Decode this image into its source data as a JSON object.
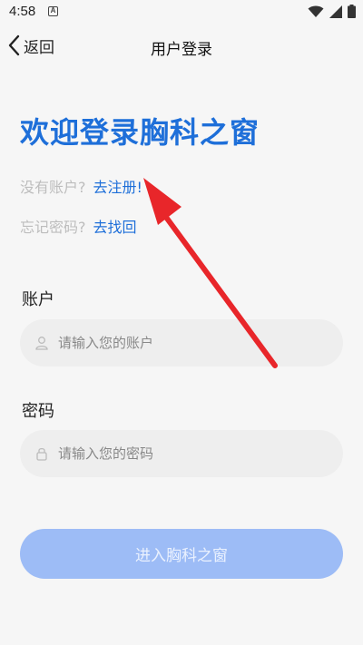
{
  "status_bar": {
    "time": "4:58",
    "badge": "A",
    "icons": [
      "wifi-icon",
      "signal-icon",
      "battery-icon"
    ]
  },
  "nav": {
    "back_label": "返回",
    "title": "用户登录"
  },
  "welcome": "欢迎登录胸科之窗",
  "register_line": {
    "prompt": "没有账户?",
    "link": "去注册!"
  },
  "recover_line": {
    "prompt": "忘记密码?",
    "link": "去找回"
  },
  "account": {
    "label": "账户",
    "placeholder": "请输入您的账户"
  },
  "password": {
    "label": "密码",
    "placeholder": "请输入您的密码"
  },
  "submit_label": "进入胸科之窗",
  "colors": {
    "accent": "#1e6fd9",
    "button": "#9dbcf6",
    "annotation_arrow": "#e8262a"
  }
}
